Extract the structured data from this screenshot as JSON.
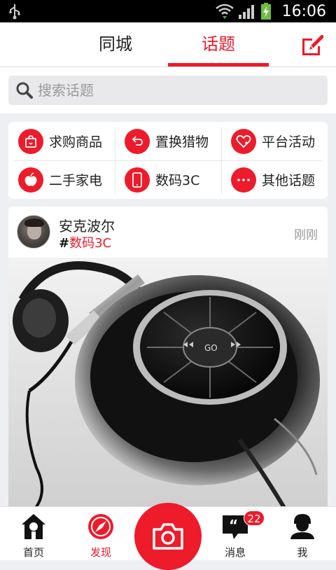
{
  "status_bar": {
    "time": "16:06"
  },
  "header": {
    "tabs": [
      {
        "label": "同城",
        "active": false
      },
      {
        "label": "话题",
        "active": true
      }
    ],
    "compose_icon": "compose-icon"
  },
  "search": {
    "placeholder": "搜索话题",
    "value": ""
  },
  "categories": [
    {
      "label": "求购商品",
      "icon": "shopping-bag-icon"
    },
    {
      "label": "置换猎物",
      "icon": "exchange-icon"
    },
    {
      "label": "平台活动",
      "icon": "heart-icon"
    },
    {
      "label": "二手家电",
      "icon": "apple-icon"
    },
    {
      "label": "数码3C",
      "icon": "phone-icon"
    },
    {
      "label": "其他话题",
      "icon": "more-icon"
    }
  ],
  "post": {
    "username": "安克波尔",
    "hash": "#",
    "topic": "数码3C",
    "time": "刚刚"
  },
  "bottom_nav": {
    "items": [
      {
        "label": "首页",
        "icon": "home-icon",
        "active": false
      },
      {
        "label": "发现",
        "icon": "compass-icon",
        "active": true
      },
      {
        "label": "消息",
        "icon": "message-icon",
        "active": false,
        "badge": "22"
      },
      {
        "label": "我",
        "icon": "user-icon",
        "active": false
      }
    ],
    "camera_icon": "camera-icon"
  },
  "colors": {
    "accent": "#ee1b2b",
    "active_tab": "#f0182a",
    "background": "#eeeff3"
  }
}
